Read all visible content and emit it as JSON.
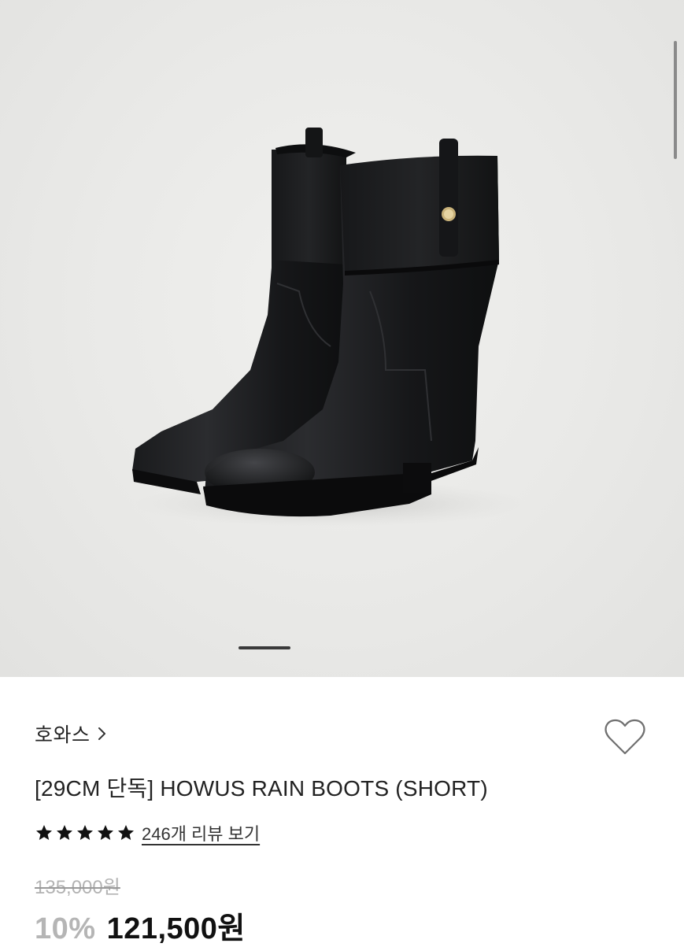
{
  "product_image": {
    "icon": "rain-boots-photo",
    "page_indicator_active": 1
  },
  "brand": {
    "name": "호와스",
    "chevron": "›"
  },
  "wishlist": {
    "icon": "heart-outline-icon"
  },
  "product": {
    "title": "[29CM 단독] HOWUS RAIN BOOTS (SHORT)"
  },
  "rating": {
    "stars": 5,
    "review_link": "246개 리뷰 보기"
  },
  "price": {
    "original": "135,000원",
    "discount": "10%",
    "sale": "121,500원"
  },
  "colors": {
    "star": "#111111",
    "discount": "#b5b5b5",
    "price": "#111111"
  }
}
